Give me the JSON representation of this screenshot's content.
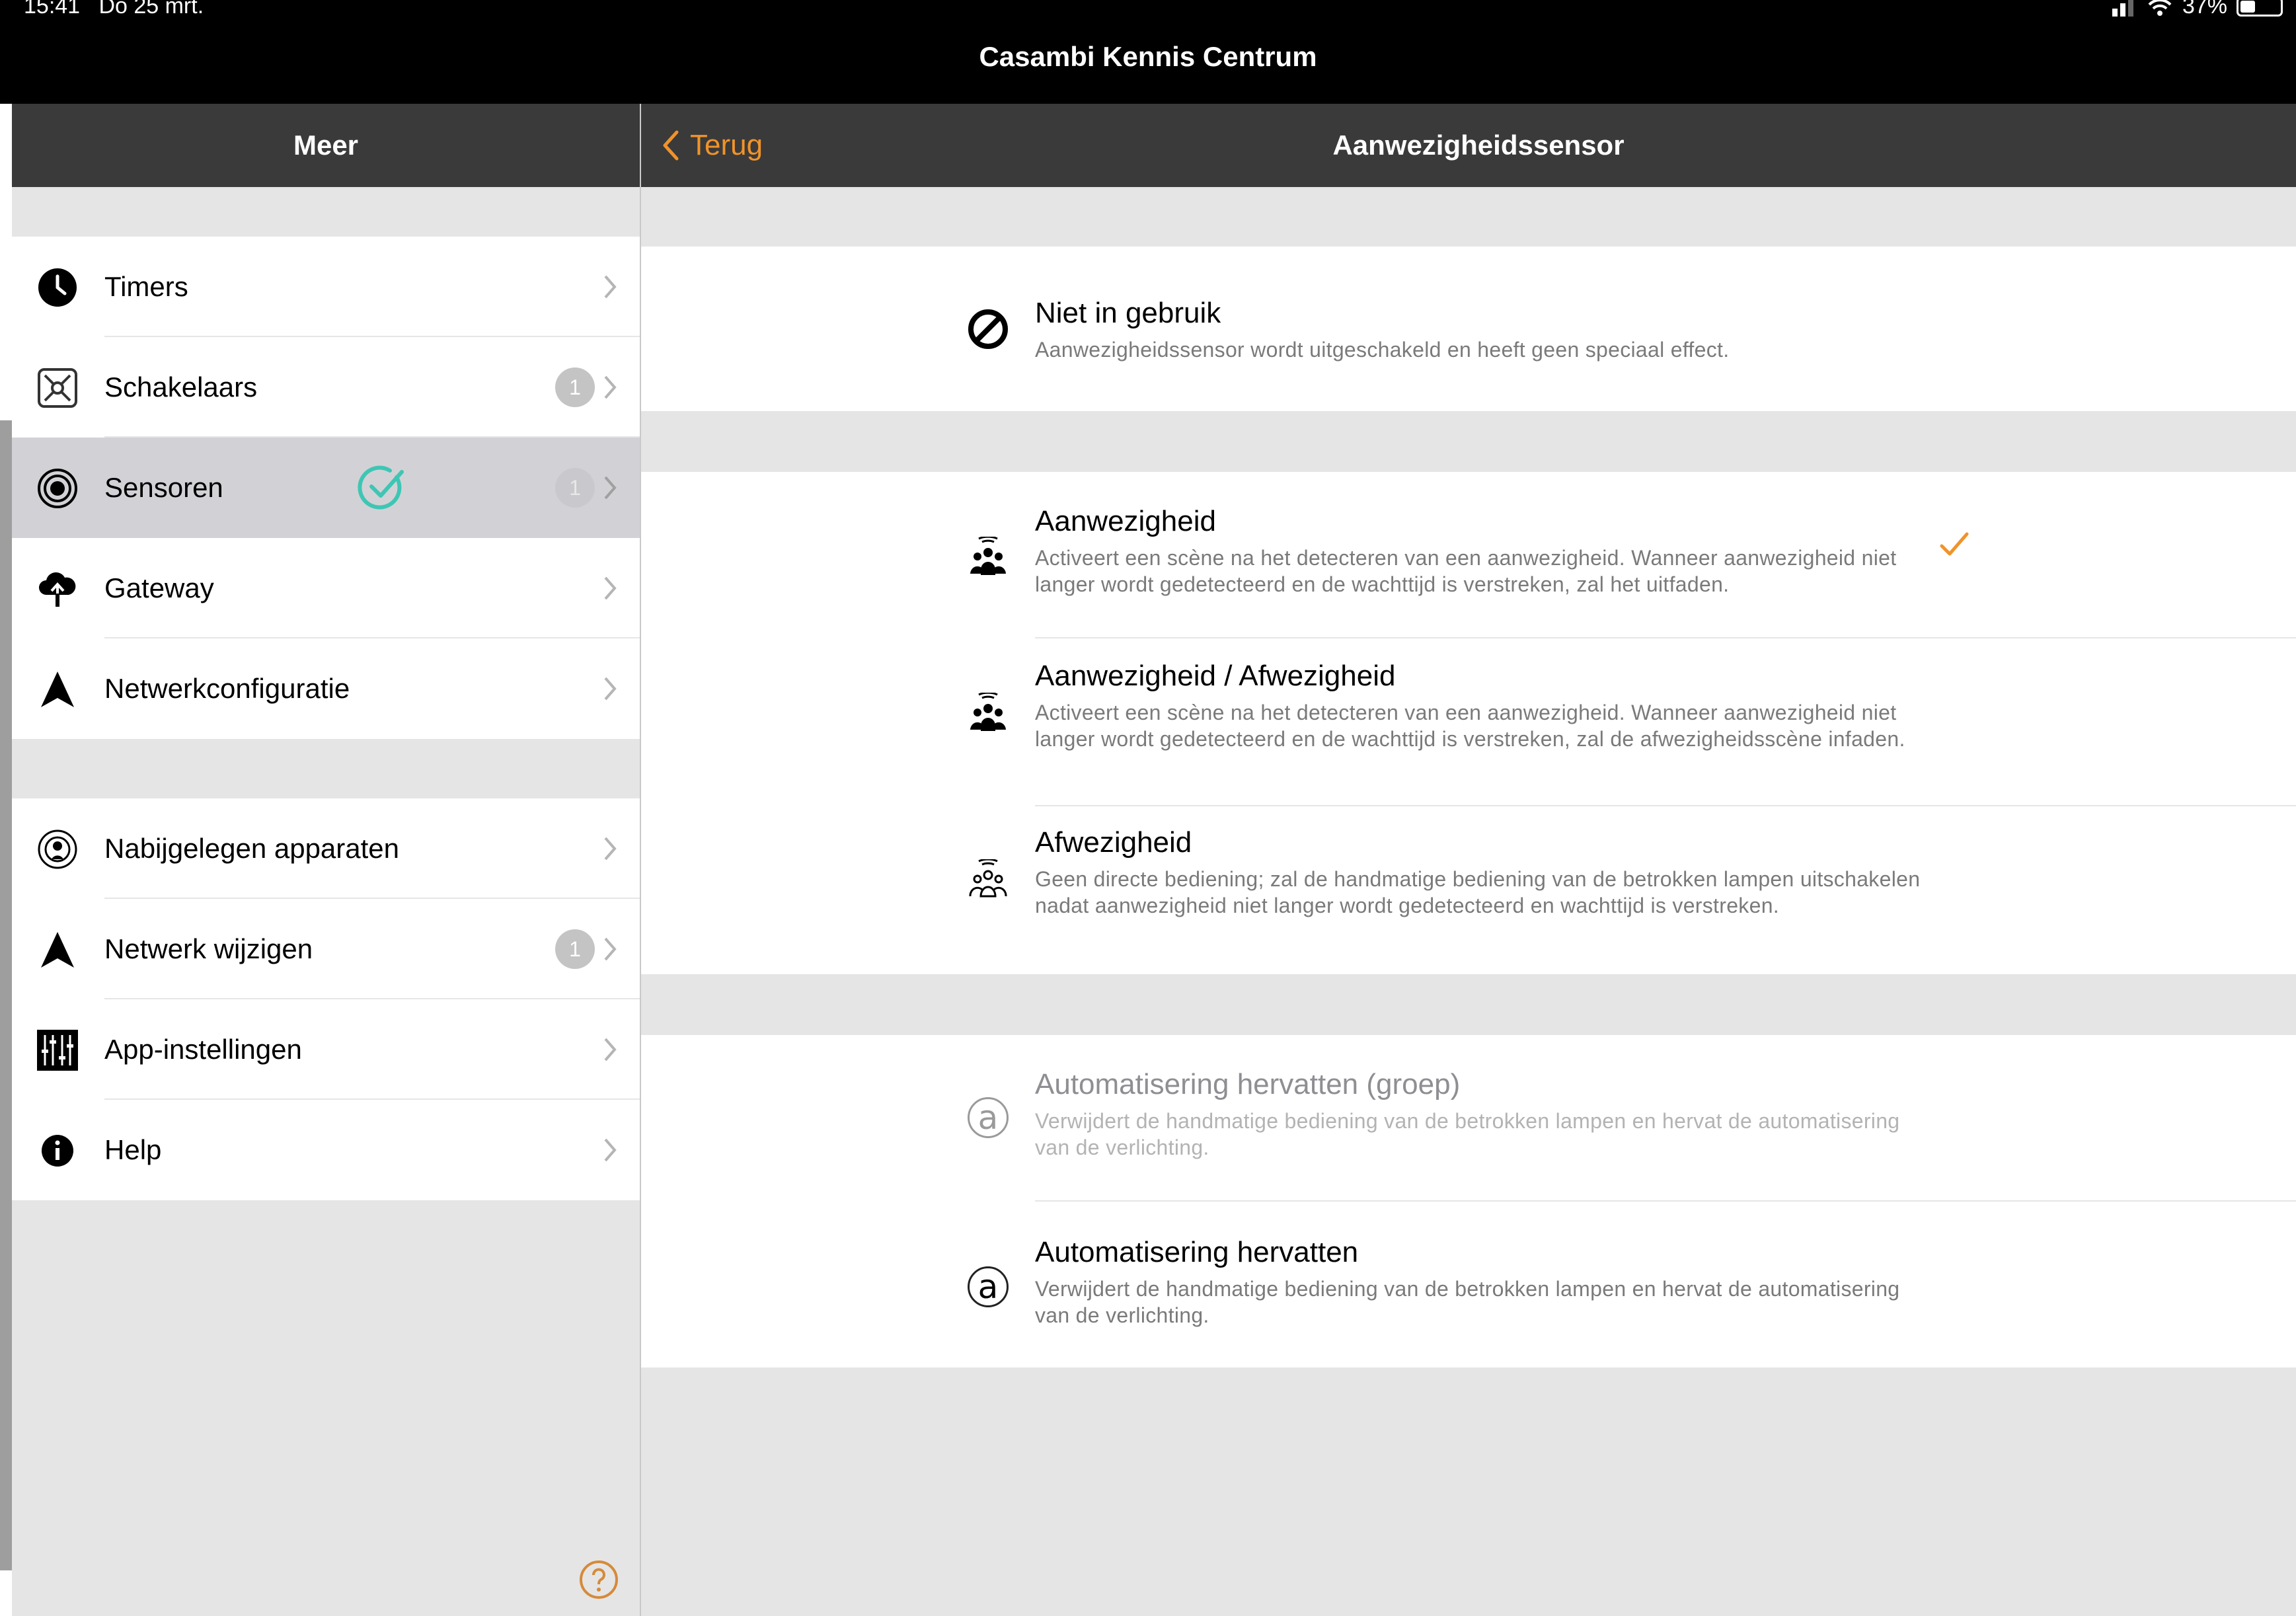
{
  "status": {
    "time": "15:41",
    "date": "Do 25 mrt.",
    "battery": "37%"
  },
  "app_title": "Casambi Kennis Centrum",
  "sidebar": {
    "title": "Meer",
    "items": [
      {
        "label": "Timers",
        "icon": "clock-icon",
        "badge": ""
      },
      {
        "label": "Schakelaars",
        "icon": "switch-icon",
        "badge": "1"
      },
      {
        "label": "Sensoren",
        "icon": "sensor-icon",
        "badge": "1",
        "selected": true
      },
      {
        "label": "Gateway",
        "icon": "cloud-upload-icon",
        "badge": ""
      },
      {
        "label": "Netwerkconfiguratie",
        "icon": "network-icon",
        "badge": ""
      },
      {
        "label": "Nabijgelegen apparaten",
        "icon": "nearby-devices-icon",
        "badge": ""
      },
      {
        "label": "Netwerk wijzigen",
        "icon": "network-icon",
        "badge": "1"
      },
      {
        "label": "App-instellingen",
        "icon": "sliders-icon",
        "badge": ""
      },
      {
        "label": "Help",
        "icon": "info-icon",
        "badge": ""
      }
    ],
    "help_icon": "question-icon"
  },
  "detail": {
    "back_label": "Terug",
    "title": "Aanwezigheidssensor",
    "options": [
      {
        "title": "Niet in gebruik",
        "desc": "Aanwezigheidssensor wordt uitgeschakeld en heeft geen speciaal effect.",
        "icon": "not-allowed-icon"
      },
      {
        "title": "Aanwezigheid",
        "desc": "Activeert een scène na het detecteren van een aanwezigheid. Wanneer aanwezigheid niet langer wordt gedetecteerd en de wachttijd is verstreken, zal het uitfaden.",
        "icon": "presence-icon",
        "checked": true
      },
      {
        "title": "Aanwezigheid / Afwezigheid",
        "desc": "Activeert een scène na het detecteren van een aanwezigheid. Wanneer aanwezigheid niet langer wordt gedetecteerd en de wachttijd is verstreken, zal de afwezigheidsscène infaden.",
        "icon": "presence-absence-icon"
      },
      {
        "title": "Afwezigheid",
        "desc": "Geen directe bediening; zal de handmatige bediening van de betrokken lampen uitschakelen nadat aanwezigheid niet langer wordt gedetecteerd en wachttijd is verstreken.",
        "icon": "absence-icon"
      },
      {
        "title": "Automatisering hervatten (groep)",
        "desc": "Verwijdert de handmatige bediening van de betrokken lampen en hervat de automatisering van de verlichting.",
        "icon": "automation-icon",
        "disabled": true
      },
      {
        "title": "Automatisering hervatten",
        "desc": "Verwijdert de handmatige bediening van de betrokken lampen en hervat de automatisering van de verlichting.",
        "icon": "automation-icon"
      }
    ]
  },
  "colors": {
    "accent": "#f0932b",
    "header": "#3a3a3a",
    "teal": "#3ec6b4"
  }
}
